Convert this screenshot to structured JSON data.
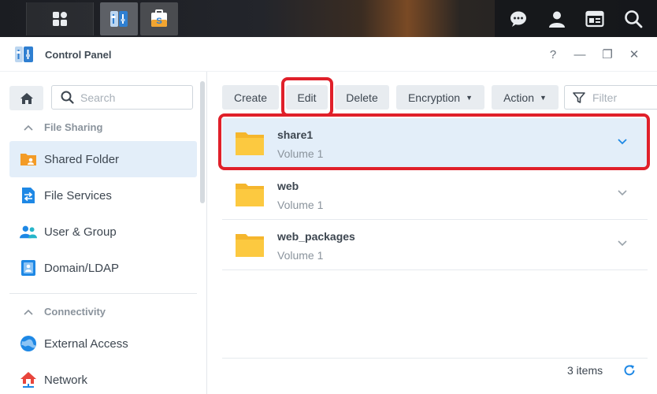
{
  "window": {
    "title": "Control Panel",
    "help": "?",
    "minimize": "—",
    "restore": "❐",
    "close": "✕"
  },
  "sidebar": {
    "search_placeholder": "Search",
    "sections": [
      {
        "label": "File Sharing",
        "items": [
          "Shared Folder",
          "File Services",
          "User & Group",
          "Domain/LDAP"
        ]
      },
      {
        "label": "Connectivity",
        "items": [
          "External Access",
          "Network"
        ]
      }
    ],
    "selected": "Shared Folder"
  },
  "toolbar": {
    "create": "Create",
    "edit": "Edit",
    "delete": "Delete",
    "encryption": "Encryption",
    "action": "Action",
    "filter_placeholder": "Filter"
  },
  "folders": [
    {
      "name": "share1",
      "volume": "Volume 1"
    },
    {
      "name": "web",
      "volume": "Volume 1"
    },
    {
      "name": "web_packages",
      "volume": "Volume 1"
    }
  ],
  "footer": {
    "count": "3 items"
  },
  "colors": {
    "accent": "#0a7bd6",
    "highlight": "#e0202a",
    "selected_bg": "#e3eef9",
    "folder": "#f8c63b"
  }
}
